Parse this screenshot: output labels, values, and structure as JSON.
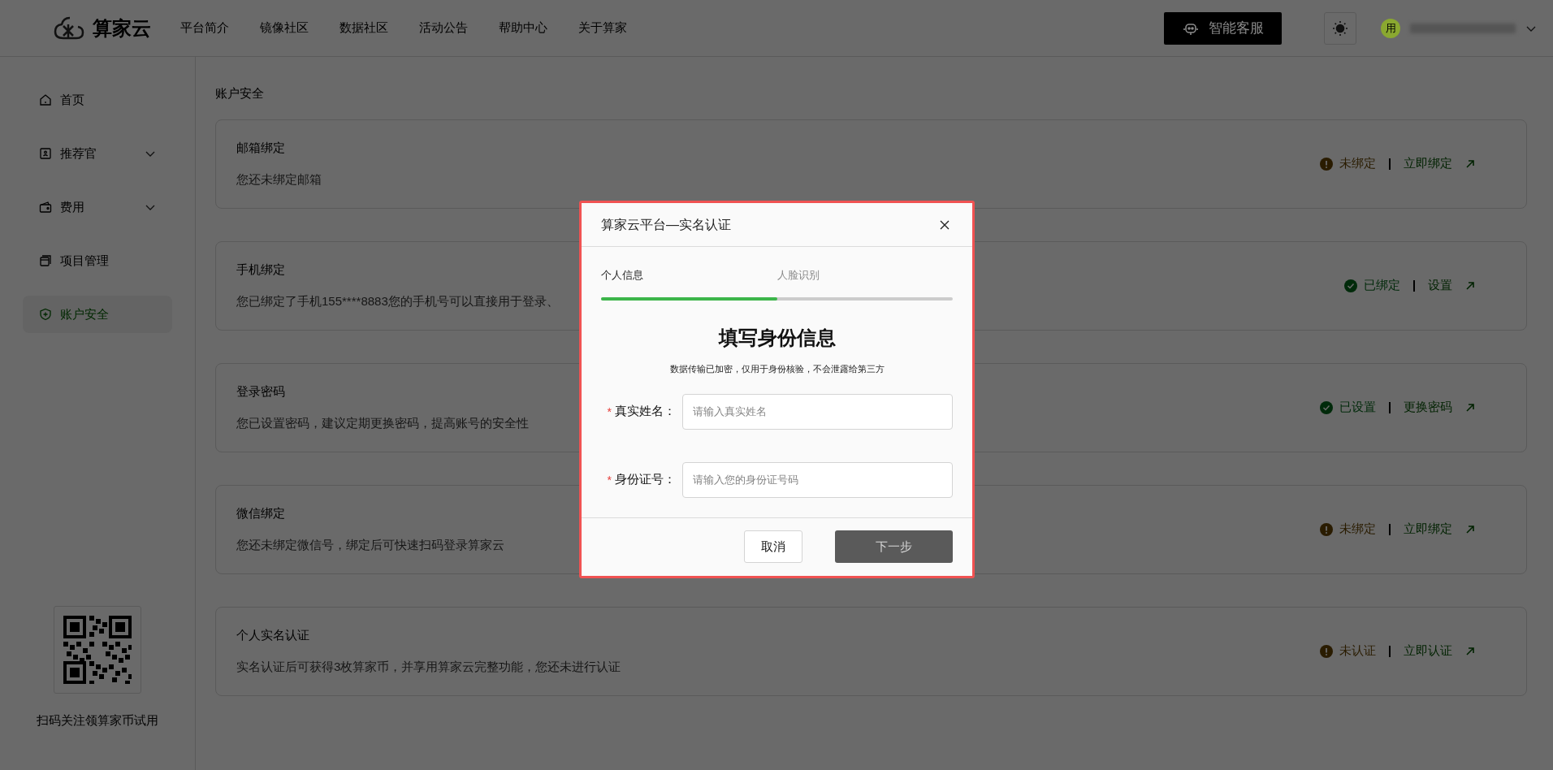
{
  "header": {
    "logo_text": "算家云",
    "nav": [
      "平台简介",
      "镜像社区",
      "数据社区",
      "活动公告",
      "帮助中心",
      "关于算家"
    ],
    "support_button": "智能客服",
    "avatar_text": "用"
  },
  "sidebar": {
    "items": [
      {
        "label": "首页",
        "expandable": false,
        "selected": false
      },
      {
        "label": "推荐官",
        "expandable": true,
        "selected": false
      },
      {
        "label": "费用",
        "expandable": true,
        "selected": false
      },
      {
        "label": "项目管理",
        "expandable": false,
        "selected": false
      },
      {
        "label": "账户安全",
        "expandable": false,
        "selected": true
      }
    ],
    "qr_caption": "扫码关注领算家币试用"
  },
  "breadcrumb": "账户安全",
  "cards": [
    {
      "title": "邮箱绑定",
      "description": "您还未绑定邮箱",
      "status": {
        "kind": "warning",
        "label": "未绑定"
      },
      "action": "立即绑定"
    },
    {
      "title": "手机绑定",
      "description": "您已绑定了手机155****8883您的手机号可以直接用于登录、",
      "status": {
        "kind": "ok",
        "label": "已绑定"
      },
      "action": "设置"
    },
    {
      "title": "登录密码",
      "description": "您已设置密码，建议定期更换密码，提高账号的安全性",
      "status": {
        "kind": "ok",
        "label": "已设置"
      },
      "action": "更换密码"
    },
    {
      "title": "微信绑定",
      "description": "您还未绑定微信号，绑定后可快速扫码登录算家云",
      "status": {
        "kind": "warning",
        "label": "未绑定"
      },
      "action": "立即绑定"
    },
    {
      "title": "个人实名认证",
      "description": "实名认证后可获得3枚算家币，并享用算家云完整功能，您还未进行认证",
      "status": {
        "kind": "warning",
        "label": "未认证"
      },
      "action": "立即认证"
    }
  ],
  "dialog": {
    "title": "算家云平台—实名认证",
    "steps": [
      {
        "label": "个人信息",
        "selected": true
      },
      {
        "label": "人脸识别",
        "selected": false
      }
    ],
    "progress": {
      "level": 0.5
    },
    "heading": "填写身份信息",
    "subtitle": "数据传输已加密，仅用于身份核验，不会泄露给第三方",
    "fields": [
      {
        "label": "真实姓名：",
        "required_mark": "*",
        "placeholder": "请输入真实姓名"
      },
      {
        "label": "身份证号：",
        "required_mark": "*",
        "placeholder": "请输入您的身份证号码"
      }
    ],
    "cancel_button": "取消",
    "next_button": "下一步"
  }
}
